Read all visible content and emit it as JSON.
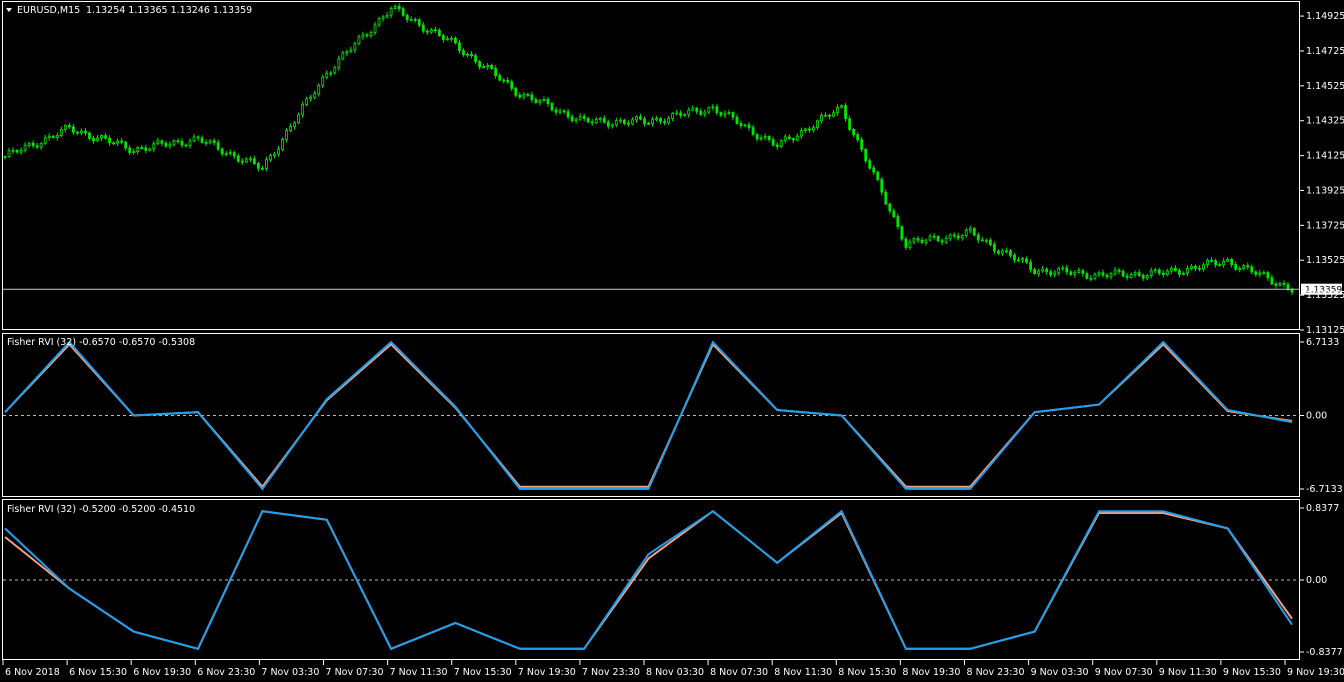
{
  "colors": {
    "background": "#000000",
    "frame": "#ffffff",
    "candle": "#00e600",
    "fisher_main": "#1ea0f0",
    "fisher_signal": "#f4a07a",
    "zero_line": "#cccccc"
  },
  "main_panel": {
    "symbol_label": "EURUSD,M15",
    "ohlc": "1.13254 1.13365 1.13246 1.13359",
    "price_ticks": [
      "1.14925",
      "1.14725",
      "1.14525",
      "1.14325",
      "1.14125",
      "1.13925",
      "1.13725",
      "1.13525",
      "1.13325",
      "1.13125"
    ],
    "current_price": "1.13359"
  },
  "indicator1": {
    "title": "Fisher RVI (32) -0.6570 -0.6570 -0.5308",
    "ticks": [
      "6.7133",
      "0.00",
      "-6.7133"
    ]
  },
  "indicator2": {
    "title": "Fisher RVI (32) -0.5200 -0.5200 -0.4510",
    "ticks": [
      "0.8377",
      "0.00",
      "-0.8377"
    ]
  },
  "time_axis": [
    "6 Nov 2018",
    "6 Nov 15:30",
    "6 Nov 19:30",
    "6 Nov 23:30",
    "7 Nov 03:30",
    "7 Nov 07:30",
    "7 Nov 11:30",
    "7 Nov 15:30",
    "7 Nov 19:30",
    "7 Nov 23:30",
    "8 Nov 03:30",
    "8 Nov 07:30",
    "8 Nov 11:30",
    "8 Nov 15:30",
    "8 Nov 19:30",
    "8 Nov 23:30",
    "9 Nov 03:30",
    "9 Nov 07:30",
    "9 Nov 11:30",
    "9 Nov 15:30",
    "9 Nov 19:30"
  ],
  "chart_data": [
    {
      "type": "line",
      "title": "EURUSD,M15",
      "x": [
        "6 Nov 2018",
        "6 Nov 15:30",
        "6 Nov 19:30",
        "6 Nov 23:30",
        "7 Nov 03:30",
        "7 Nov 07:30",
        "7 Nov 11:30",
        "7 Nov 15:30",
        "7 Nov 19:30",
        "7 Nov 23:30",
        "8 Nov 03:30",
        "8 Nov 07:30",
        "8 Nov 11:30",
        "8 Nov 15:30",
        "8 Nov 19:30",
        "8 Nov 23:30",
        "9 Nov 03:30",
        "9 Nov 07:30",
        "9 Nov 11:30",
        "9 Nov 15:30",
        "9 Nov 19:30"
      ],
      "series": [
        {
          "values": [
            1.1412,
            1.1428,
            1.1416,
            1.1422,
            1.1405,
            1.146,
            1.1497,
            1.1476,
            1.1448,
            1.1432,
            1.1432,
            1.144,
            1.1418,
            1.144,
            1.1362,
            1.1368,
            1.1347,
            1.1344,
            1.1345,
            1.1352,
            1.1336
          ]
        }
      ],
      "ylim": [
        1.13125,
        1.15
      ]
    },
    {
      "type": "line",
      "title": "Fisher RVI (32) -0.6570 -0.6570 -0.5308",
      "x": [
        "6 Nov 2018",
        "6 Nov 15:30",
        "6 Nov 19:30",
        "6 Nov 23:30",
        "7 Nov 03:30",
        "7 Nov 07:30",
        "7 Nov 11:30",
        "7 Nov 15:30",
        "7 Nov 19:30",
        "7 Nov 23:30",
        "8 Nov 03:30",
        "8 Nov 07:30",
        "8 Nov 11:30",
        "8 Nov 15:30",
        "8 Nov 19:30",
        "8 Nov 23:30",
        "9 Nov 03:30",
        "9 Nov 07:30",
        "9 Nov 11:30",
        "9 Nov 15:30",
        "9 Nov 19:30"
      ],
      "series": [
        {
          "values": [
            0.3,
            6.7,
            0.0,
            0.3,
            -6.7,
            1.5,
            6.7,
            0.8,
            -6.7,
            -6.7,
            -6.7,
            6.7,
            0.5,
            0.0,
            -6.7,
            -6.7,
            0.3,
            1.0,
            6.7,
            0.5,
            -0.6
          ]
        },
        {
          "values": [
            0.3,
            6.5,
            0.0,
            0.3,
            -6.5,
            1.4,
            6.5,
            0.7,
            -6.5,
            -6.5,
            -6.5,
            6.5,
            0.5,
            0.0,
            -6.5,
            -6.5,
            0.3,
            1.0,
            6.5,
            0.4,
            -0.5
          ]
        }
      ],
      "ylim": [
        -6.7133,
        6.7133
      ]
    },
    {
      "type": "line",
      "title": "Fisher RVI (32) -0.5200 -0.5200 -0.4510",
      "x": [
        "6 Nov 2018",
        "6 Nov 15:30",
        "6 Nov 19:30",
        "6 Nov 23:30",
        "7 Nov 03:30",
        "7 Nov 07:30",
        "7 Nov 11:30",
        "7 Nov 15:30",
        "7 Nov 19:30",
        "7 Nov 23:30",
        "8 Nov 03:30",
        "8 Nov 07:30",
        "8 Nov 11:30",
        "8 Nov 15:30",
        "8 Nov 19:30",
        "8 Nov 23:30",
        "9 Nov 03:30",
        "9 Nov 07:30",
        "9 Nov 11:30",
        "9 Nov 15:30",
        "9 Nov 19:30"
      ],
      "series": [
        {
          "values": [
            0.6,
            -0.1,
            -0.6,
            -0.8,
            0.8,
            0.7,
            -0.8,
            -0.5,
            -0.8,
            -0.8,
            0.3,
            0.8,
            0.2,
            0.8,
            -0.8,
            -0.8,
            -0.6,
            0.8,
            0.8,
            0.6,
            -0.52
          ]
        },
        {
          "values": [
            0.5,
            -0.1,
            -0.6,
            -0.8,
            0.8,
            0.7,
            -0.8,
            -0.5,
            -0.8,
            -0.8,
            0.25,
            0.8,
            0.2,
            0.78,
            -0.8,
            -0.8,
            -0.6,
            0.78,
            0.78,
            0.6,
            -0.45
          ]
        }
      ],
      "ylim": [
        -0.8377,
        0.8377
      ]
    }
  ]
}
